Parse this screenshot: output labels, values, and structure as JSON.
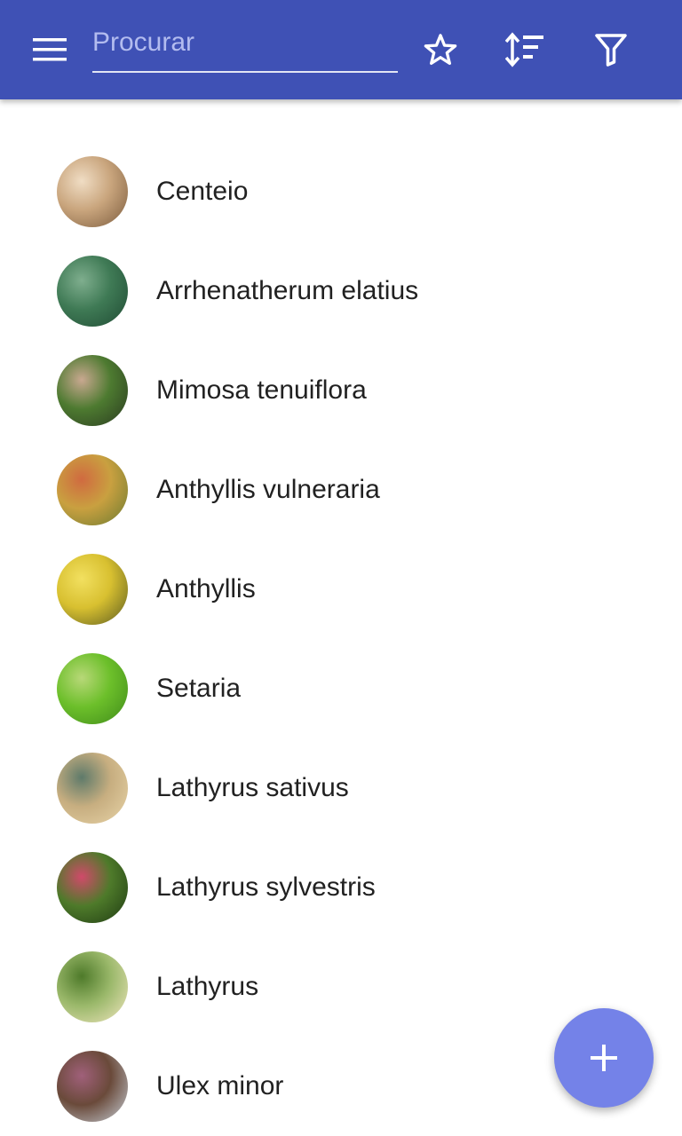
{
  "toolbar": {
    "menu_icon": "menu-icon",
    "search_placeholder": "Procurar",
    "search_value": "",
    "favorite_icon": "star-outline-icon",
    "sort_icon": "sort-icon",
    "filter_icon": "filter-icon",
    "color": "#3f51b5"
  },
  "plants": [
    {
      "name": "Centeio",
      "thumb_colors": [
        "#7a5a3c",
        "#c9a57d",
        "#f0ddc4"
      ]
    },
    {
      "name": "Arrhenatherum elatius",
      "thumb_colors": [
        "#1f4a33",
        "#3f7a55",
        "#7fae8e"
      ]
    },
    {
      "name": "Mimosa tenuiflora",
      "thumb_colors": [
        "#2a3a20",
        "#4d7a30",
        "#c9a890"
      ]
    },
    {
      "name": "Anthyllis vulneraria",
      "thumb_colors": [
        "#6a7a30",
        "#c9a040",
        "#d06a40"
      ]
    },
    {
      "name": "Anthyllis",
      "thumb_colors": [
        "#5a5a20",
        "#d8c030",
        "#f2e060"
      ]
    },
    {
      "name": "Setaria",
      "thumb_colors": [
        "#3f8a1a",
        "#6cbf2a",
        "#b8d878"
      ]
    },
    {
      "name": "Lathyrus sativus",
      "thumb_colors": [
        "#e8d4a8",
        "#c7ae80",
        "#5e7a6a"
      ]
    },
    {
      "name": "Lathyrus sylvestris",
      "thumb_colors": [
        "#1e3a12",
        "#4e7a2a",
        "#d04a6a"
      ]
    },
    {
      "name": "Lathyrus",
      "thumb_colors": [
        "#f2e6c0",
        "#9ab86a",
        "#4e7a2a"
      ]
    },
    {
      "name": "Ulex minor",
      "thumb_colors": [
        "#c8d0d8",
        "#6a4a3a",
        "#a0607a"
      ]
    }
  ],
  "fab": {
    "icon": "plus-icon",
    "color": "#7482e8"
  }
}
